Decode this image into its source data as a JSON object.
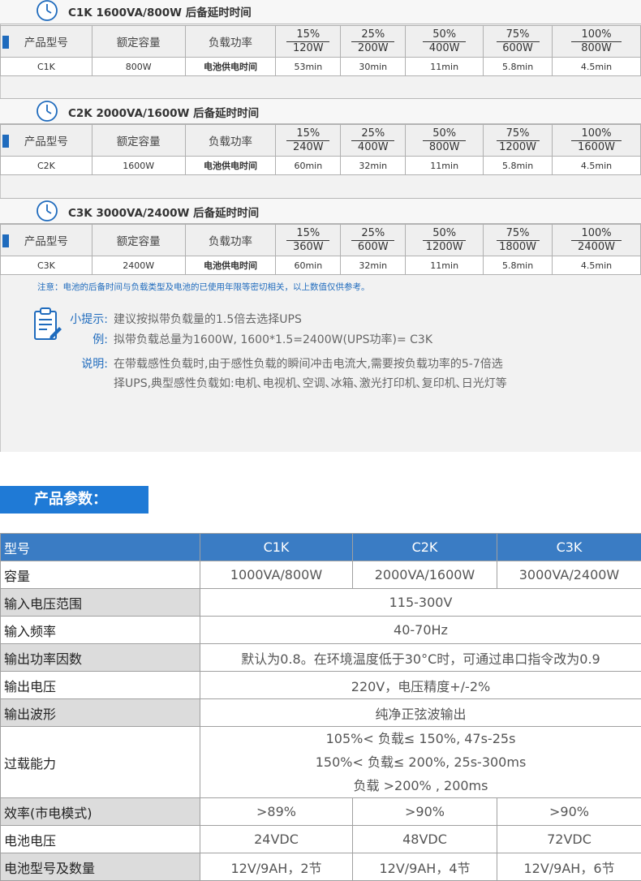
{
  "sections": [
    {
      "title": "C1K 1600VA/800W 后备延时时间",
      "headers": {
        "model": "产品型号",
        "capacity": "额定容量",
        "load": "负载功率"
      },
      "loads": [
        {
          "pct": "15%",
          "watt": "120W"
        },
        {
          "pct": "25%",
          "watt": "200W"
        },
        {
          "pct": "50%",
          "watt": "400W"
        },
        {
          "pct": "75%",
          "watt": "600W"
        },
        {
          "pct": "100%",
          "watt": "800W"
        }
      ],
      "row": {
        "model": "C1K",
        "capacity": "800W",
        "label": "电池供电时间",
        "times": [
          "53min",
          "30min",
          "11min",
          "5.8min",
          "4.5min"
        ]
      }
    },
    {
      "title": "C2K  2000VA/1600W 后备延时时间",
      "headers": {
        "model": "产品型号",
        "capacity": "额定容量",
        "load": "负载功率"
      },
      "loads": [
        {
          "pct": "15%",
          "watt": "240W"
        },
        {
          "pct": "25%",
          "watt": "400W"
        },
        {
          "pct": "50%",
          "watt": "800W"
        },
        {
          "pct": "75%",
          "watt": "1200W"
        },
        {
          "pct": "100%",
          "watt": "1600W"
        }
      ],
      "row": {
        "model": "C2K",
        "capacity": "1600W",
        "label": "电池供电时间",
        "times": [
          "60min",
          "32min",
          "11min",
          "5.8min",
          "4.5min"
        ]
      }
    },
    {
      "title": "C3K 3000VA/2400W 后备延时时间",
      "headers": {
        "model": "产品型号",
        "capacity": "额定容量",
        "load": "负载功率"
      },
      "loads": [
        {
          "pct": "15%",
          "watt": "360W"
        },
        {
          "pct": "25%",
          "watt": "600W"
        },
        {
          "pct": "50%",
          "watt": "1200W"
        },
        {
          "pct": "75%",
          "watt": "1800W"
        },
        {
          "pct": "100%",
          "watt": "2400W"
        }
      ],
      "row": {
        "model": "C3K",
        "capacity": "2400W",
        "label": "电池供电时间",
        "times": [
          "60min",
          "32min",
          "11min",
          "5.8min",
          "4.5min"
        ]
      }
    }
  ],
  "note": "注意：电池的后备时间与负载类型及电池的已使用年限等密切相关，以上数值仅供参考。",
  "tips": {
    "tip_label": "小提示:",
    "tip_text": "建议按拟带负载量的1.5倍去选择UPS",
    "example_label": "例:",
    "example_text": "拟带负载总量为1600W, 1600*1.5=2400W(UPS功率)= C3K",
    "explain_label": "说明:",
    "explain_line1": "在带载感性负载时,由于感性负载的瞬间冲击电流大,需要按负载功率的5-7倍选",
    "explain_line2": "择UPS,典型感性负载如:电机､电视机､空调､冰箱､激光打印机､复印机､日光灯等"
  },
  "param_title": "产品参数：",
  "params": {
    "head": {
      "label": "型号",
      "c1": "C1K",
      "c2": "C2K",
      "c3": "C3K"
    },
    "capacity": {
      "label": "容量",
      "c1": "1000VA/800W",
      "c2": "2000VA/1600W",
      "c3": "3000VA/2400W"
    },
    "input_voltage": {
      "label": "输入电压范围",
      "value": "115-300V"
    },
    "input_freq": {
      "label": "输入频率",
      "value": "40-70Hz"
    },
    "power_factor": {
      "label": "输出功率因数",
      "value": "默认为0.8。在环境温度低于30°C时，可通过串口指令改为0.9"
    },
    "output_voltage": {
      "label": "输出电压",
      "value": "220V，电压精度+/-2%"
    },
    "waveform": {
      "label": "输出波形",
      "value": "纯净正弦波输出"
    },
    "overload": {
      "label": "过载能力",
      "line1": "105%< 负载≤ 150%, 47s-25s",
      "line2": "150%< 负载≤ 200%, 25s-300ms",
      "line3": "负载 >200% , 200ms"
    },
    "efficiency": {
      "label": "效率(市电模式)",
      "c1": ">89%",
      "c2": ">90%",
      "c3": ">90%"
    },
    "battery_voltage": {
      "label": "电池电压",
      "c1": "24VDC",
      "c2": "48VDC",
      "c3": "72VDC"
    },
    "battery_type": {
      "label": "电池型号及数量",
      "c1": "12V/9AH，2节",
      "c2": "12V/9AH，4节",
      "c3": "12V/9AH，6节"
    }
  },
  "colors": {
    "accent": "#1f7ad6",
    "table_head": "#3a7cc4",
    "note_blue": "#1f6bbd"
  }
}
